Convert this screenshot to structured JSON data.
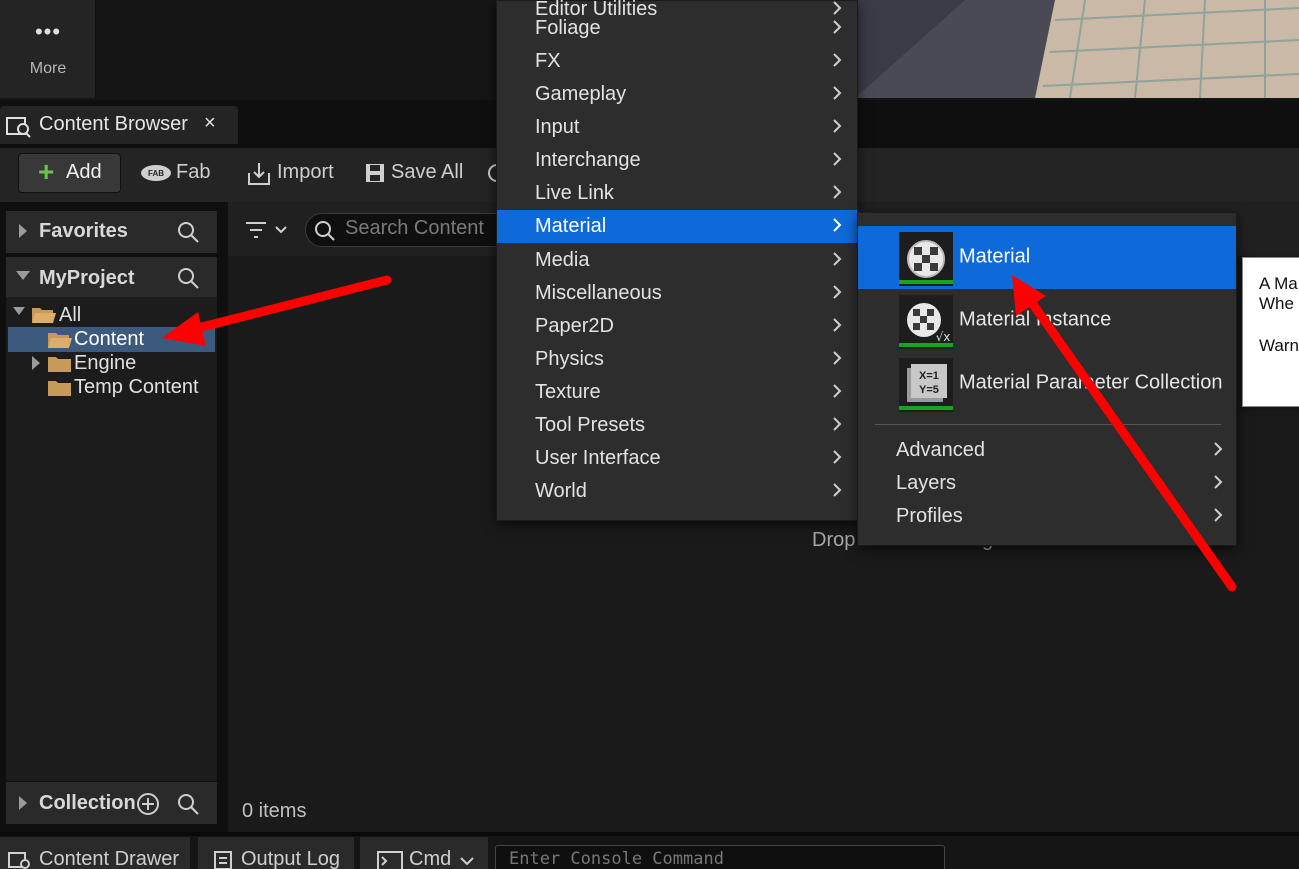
{
  "toolbar_top": {
    "more_label": "More",
    "more_dots": "•••"
  },
  "tab": {
    "label": "Content Browser",
    "close": "×"
  },
  "toolbar": {
    "add_label": "Add",
    "add_plus": "+",
    "fab_label": "Fab",
    "import_label": "Import",
    "save_all_label": "Save All"
  },
  "sidebar": {
    "favorites_title": "Favorites",
    "project_title": "MyProject",
    "collection_title": "Collection",
    "tree": {
      "all": "All",
      "content": "Content",
      "engine": "Engine",
      "temp": "Temp Content"
    }
  },
  "content": {
    "search_placeholder": "Search Content",
    "items_count": "0 items",
    "drop_hint": "Drop files here or right-click to create content"
  },
  "bottom": {
    "content_drawer": "Content Drawer",
    "output_log": "Output Log",
    "cmd": "Cmd",
    "console_placeholder": "Enter Console Command"
  },
  "menu": {
    "items": [
      {
        "label": "Editor Utilities"
      },
      {
        "label": "Foliage"
      },
      {
        "label": "FX"
      },
      {
        "label": "Gameplay"
      },
      {
        "label": "Input"
      },
      {
        "label": "Interchange"
      },
      {
        "label": "Live Link"
      },
      {
        "label": "Material",
        "highlighted": true
      },
      {
        "label": "Media"
      },
      {
        "label": "Miscellaneous"
      },
      {
        "label": "Paper2D"
      },
      {
        "label": "Physics"
      },
      {
        "label": "Texture"
      },
      {
        "label": "Tool Presets"
      },
      {
        "label": "User Interface"
      },
      {
        "label": "World"
      }
    ],
    "chevron": ">"
  },
  "submenu": {
    "assets": [
      {
        "label": "Material",
        "icon": "material-icon",
        "highlighted": true
      },
      {
        "label": "Material Instance",
        "icon": "material-instance-icon"
      },
      {
        "label": "Material Parameter Collection",
        "icon": "material-parameter-collection-icon"
      }
    ],
    "categories": [
      {
        "label": "Advanced"
      },
      {
        "label": "Layers"
      },
      {
        "label": "Profiles"
      }
    ]
  },
  "tooltip": {
    "line1": "A Ma",
    "line2": "Whe",
    "line3": "Warn"
  },
  "colors": {
    "highlight": "#0e6ad9",
    "selection": "#3c5a7e",
    "asset_bar": "#16a51c",
    "arrow": "#ff0000"
  }
}
